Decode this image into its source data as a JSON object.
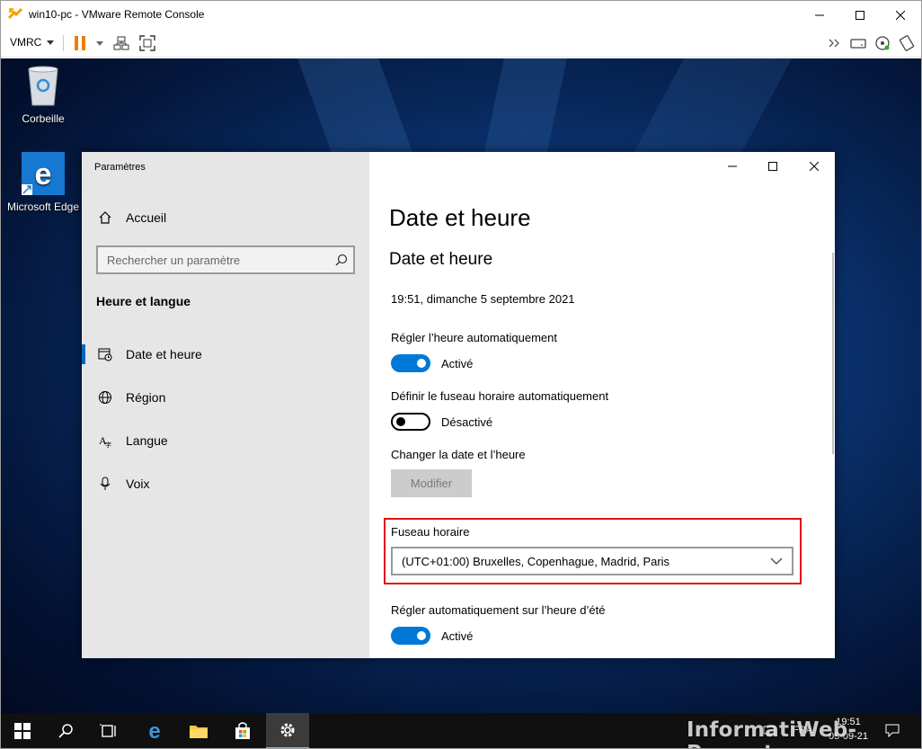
{
  "vmrc": {
    "window_title": "win10-pc - VMware Remote Console",
    "menu_label": "VMRC"
  },
  "desktop": {
    "icons": [
      {
        "label": "Corbeille",
        "icon": "recycle-bin-icon"
      },
      {
        "label": "Microsoft Edge",
        "icon": "edge-icon"
      }
    ]
  },
  "settings": {
    "window_title": "Paramètres",
    "home_label": "Accueil",
    "search": {
      "placeholder": "Rechercher un paramètre"
    },
    "section_heading": "Heure et langue",
    "nav": [
      {
        "label": "Date et heure",
        "icon": "calendar-clock-icon",
        "active": true
      },
      {
        "label": "Région",
        "icon": "globe-icon",
        "active": false
      },
      {
        "label": "Langue",
        "icon": "language-icon",
        "active": false
      },
      {
        "label": "Voix",
        "icon": "microphone-icon",
        "active": false
      }
    ],
    "page_title": "Date et heure",
    "subtitle": "Date et heure",
    "current_datetime": "19:51, dimanche 5 septembre 2021",
    "auto_time": {
      "label": "Régler l’heure automatiquement",
      "state": "Activé",
      "on": true
    },
    "auto_timezone": {
      "label": "Définir le fuseau horaire automatiquement",
      "state": "Désactivé",
      "on": false
    },
    "change_datetime": {
      "label": "Changer la date et l’heure",
      "button": "Modifier"
    },
    "timezone": {
      "label": "Fuseau horaire",
      "value": "(UTC+01:00) Bruxelles, Copenhague, Madrid, Paris"
    },
    "dst": {
      "label": "Régler automatiquement sur l’heure d’été",
      "state": "Activé",
      "on": true
    }
  },
  "taskbar": {
    "lang": "FRA",
    "time": "19:51",
    "date": "05-09-21",
    "active_app": "settings"
  },
  "watermark": "InformatiWeb-Pro.net",
  "colors": {
    "accent": "#0078d7",
    "highlight_box": "#e01010",
    "sidebar_bg": "#e6e6e6"
  }
}
